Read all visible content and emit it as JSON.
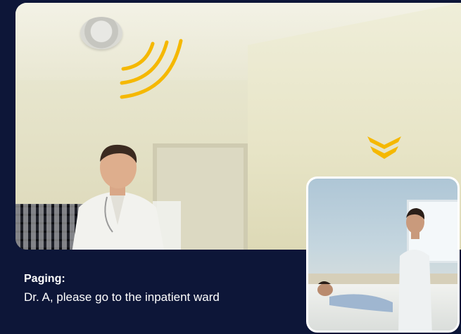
{
  "caption": {
    "title": "Paging:",
    "message": "Dr. A, please go to the inpatient ward"
  },
  "colors": {
    "background": "#0d1638",
    "accent": "#f5b800",
    "text": "#ffffff"
  },
  "icons": [
    "sound-waves-icon",
    "chevron-down-icon"
  ]
}
